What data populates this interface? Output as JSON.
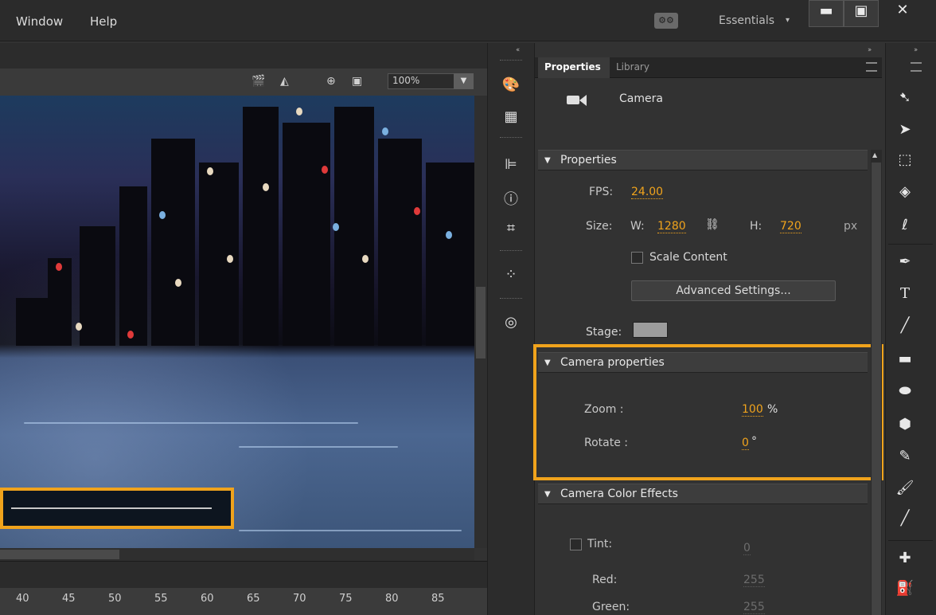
{
  "menu": {
    "items": [
      "Window",
      "Help"
    ]
  },
  "workspace": {
    "switch_icon": "workspace-icon",
    "label": "Essentials",
    "caret": "▾"
  },
  "window_controls": {
    "minimize": "▬",
    "restore": "▣",
    "close": "✕"
  },
  "stage_toolbar": {
    "zoom_value": "100%"
  },
  "timeline": {
    "frame_ticks": [
      "40",
      "45",
      "50",
      "55",
      "60",
      "65",
      "70",
      "75",
      "80",
      "85"
    ]
  },
  "properties_panel": {
    "tabs": [
      "Properties",
      "Library"
    ],
    "object_type": "Camera",
    "sections": {
      "properties": {
        "title": "Properties",
        "fps_label": "FPS:",
        "fps_value": "24.00",
        "size_label": "Size:",
        "w_label": "W:",
        "w_value": "1280",
        "h_label": "H:",
        "h_value": "720",
        "unit": "px",
        "scale_content_label": "Scale Content",
        "scale_content_checked": false,
        "advanced_button": "Advanced Settings...",
        "stage_label": "Stage:",
        "stage_color": "#9c9c9c"
      },
      "camera": {
        "title": "Camera properties",
        "zoom_label": "Zoom :",
        "zoom_value": "100",
        "zoom_unit": "%",
        "rotate_label": "Rotate :",
        "rotate_value": "0",
        "rotate_unit": "°"
      },
      "color_effects": {
        "title": "Camera Color Effects",
        "tint_label": "Tint:",
        "tint_checked": false,
        "tint_value": "0",
        "red_label": "Red:",
        "red_value": "255",
        "green_label": "Green:",
        "green_value": "255"
      }
    }
  },
  "colors": {
    "accent_highlight": "#f0a31c",
    "value_text": "#f0a31c",
    "panel_bg": "#323232"
  }
}
